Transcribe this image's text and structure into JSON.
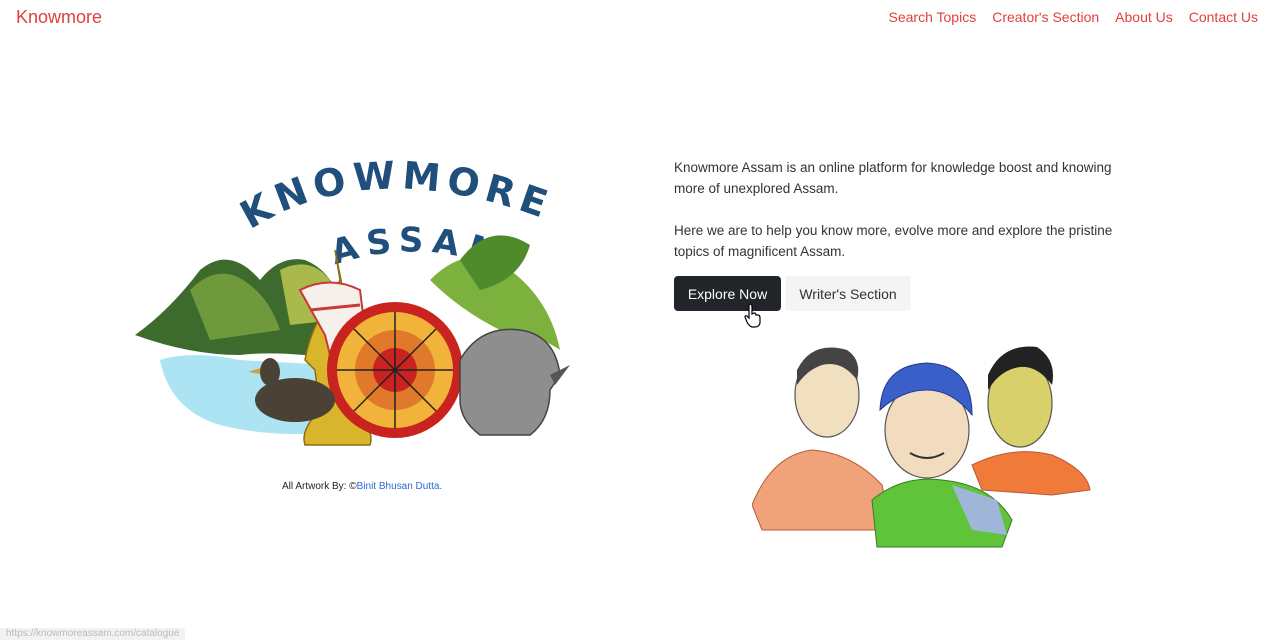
{
  "nav": {
    "brand": "Knowmore",
    "links": [
      "Search Topics",
      "Creator's Section",
      "About Us",
      "Contact Us"
    ]
  },
  "hero": {
    "logo_line1": "KNOWMORE",
    "logo_line2": "ASSAM",
    "credit_prefix": "All Artwork By: ©",
    "credit_artist": "Binit Bhusan Dutta."
  },
  "intro": {
    "paragraph1": "Knowmore Assam is an online platform for knowledge boost and knowing more of unexplored Assam.",
    "paragraph2": "Here we are to help you know more, evolve more and explore the pristine topics of magnificent Assam."
  },
  "buttons": {
    "explore": "Explore Now",
    "writers": "Writer's Section"
  },
  "status_bar": {
    "url": "https://knowmoreassam.com/catalogue"
  },
  "colors": {
    "brand_red": "#e0403e",
    "link_blue": "#2b6ad6",
    "button_dark": "#212529"
  }
}
